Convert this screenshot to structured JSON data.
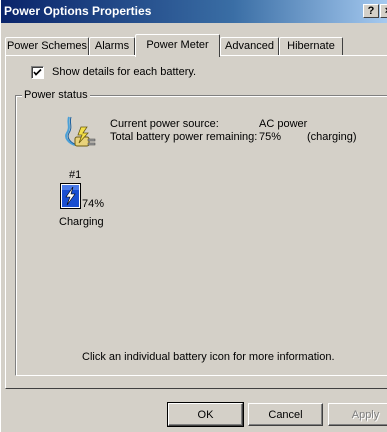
{
  "window": {
    "title": "Power Options Properties",
    "help_glyph": "?",
    "close_glyph": "×"
  },
  "tabs": [
    {
      "label": "Power Schemes",
      "active": false
    },
    {
      "label": "Alarms",
      "active": false
    },
    {
      "label": "Power Meter",
      "active": true
    },
    {
      "label": "Advanced",
      "active": false
    },
    {
      "label": "Hibernate",
      "active": false
    }
  ],
  "options": {
    "show_details_label": "Show details for each battery.",
    "show_details_checked": true
  },
  "power_status": {
    "group_title": "Power status",
    "source_icon": "ac-power-plug-icon",
    "current_source_label": "Current power source:",
    "current_source_value": "AC power",
    "remaining_label": "Total battery power remaining:",
    "remaining_value": "75%",
    "remaining_state": "(charging)"
  },
  "batteries": [
    {
      "number": "#1",
      "icon": "battery-charging-icon",
      "percent": "74%",
      "status": "Charging"
    }
  ],
  "hint": "Click an individual battery icon for more information.",
  "buttons": {
    "ok": "OK",
    "cancel": "Cancel",
    "apply": "Apply"
  },
  "colors": {
    "titlebar_start": "#0a246a",
    "titlebar_end": "#a6caf0",
    "face": "#d4d0c8",
    "battery_fill": "#1a4fd1"
  }
}
